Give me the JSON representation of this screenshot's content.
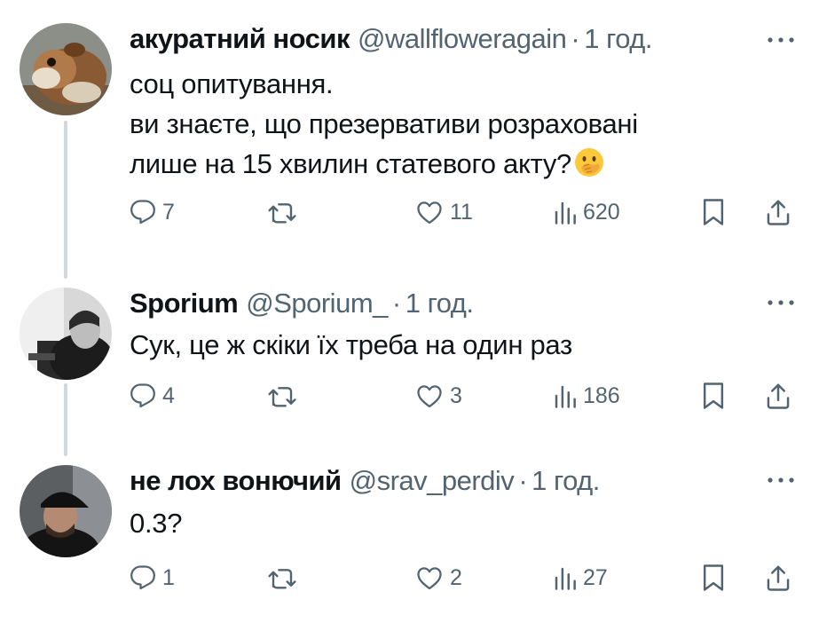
{
  "tweets": [
    {
      "name": "акуратний носик",
      "handle": "@wallfloweragain",
      "separator": "·",
      "time": "1 год.",
      "text_lines": [
        "соц опитування.",
        "ви знаєте, що презервативи розраховані",
        "лише на 15 хвилин статевого акту?"
      ],
      "emoji": "face-with-hand-over-mouth-emoji",
      "replies": "7",
      "retweets": "",
      "likes": "11",
      "views": "620"
    },
    {
      "name": "Sporium",
      "handle": "@Sporium_",
      "separator": "·",
      "time": "1 год.",
      "text_lines": [
        "Сук, це ж скіки їх треба на один раз"
      ],
      "replies": "4",
      "retweets": "",
      "likes": "3",
      "views": "186"
    },
    {
      "name": "не лох вонючий",
      "handle": "@srav_perdiv",
      "separator": "·",
      "time": "1 год.",
      "text_lines": [
        "0.3?"
      ],
      "replies": "1",
      "retweets": "",
      "likes": "2",
      "views": "27"
    }
  ],
  "icons": {
    "reply": "reply-icon",
    "retweet": "retweet-icon",
    "like": "like-icon",
    "views": "views-icon",
    "bookmark": "bookmark-icon",
    "share": "share-icon",
    "more": "more-icon"
  },
  "colors": {
    "text": "#0f1419",
    "secondary": "#536471",
    "thread_line": "#cfd9de"
  }
}
